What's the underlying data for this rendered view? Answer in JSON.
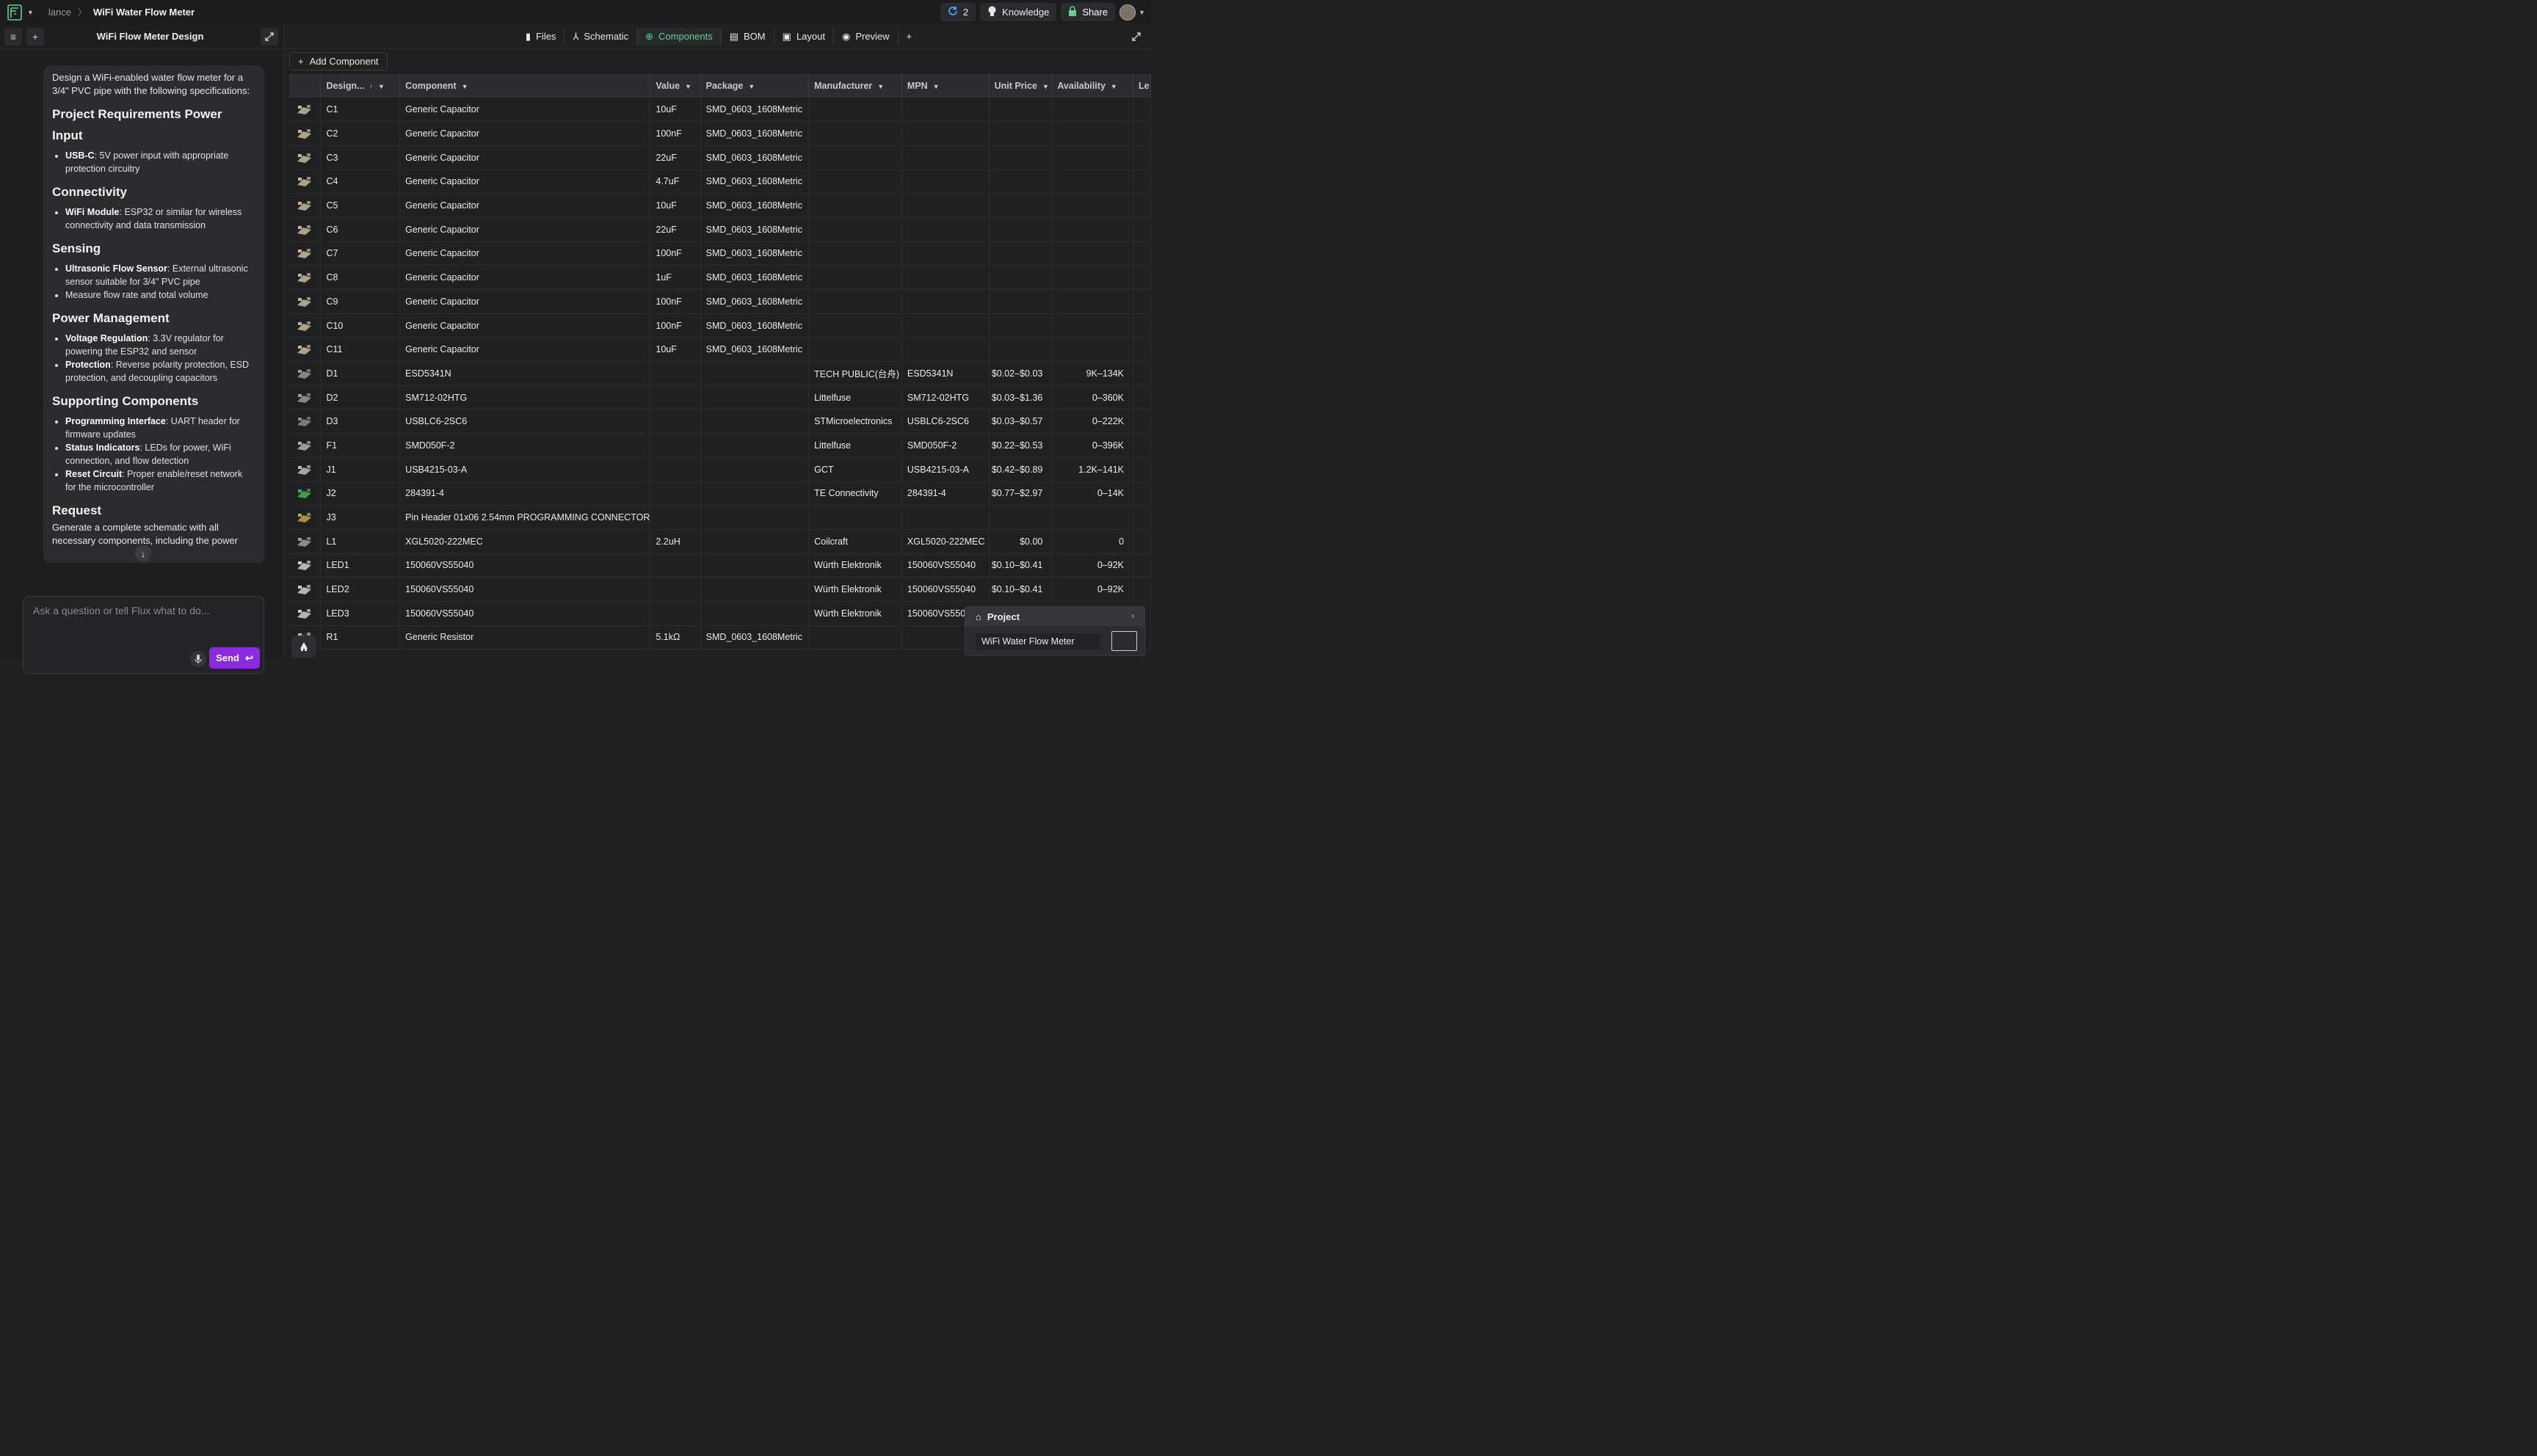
{
  "topbar": {
    "user": "lance",
    "project_title": "WiFi Water Flow Meter",
    "sync_count": "2",
    "knowledge_label": "Knowledge",
    "share_label": "Share"
  },
  "left": {
    "title": "WiFi Flow Meter Design",
    "intro": "Design a WiFi-enabled water flow meter for a 3/4\" PVC pipe with the following specifications:",
    "sections": [
      {
        "heading": "Project Requirements Power Input",
        "items": [
          {
            "bold": "USB-C",
            "text": ": 5V power input with appropriate protection circuitry"
          }
        ]
      },
      {
        "heading": "Connectivity",
        "items": [
          {
            "bold": "WiFi Module",
            "text": ": ESP32 or similar for wireless connectivity and data transmission"
          }
        ]
      },
      {
        "heading": "Sensing",
        "items": [
          {
            "bold": "Ultrasonic Flow Sensor",
            "text": ": External ultrasonic sensor suitable for 3/4\" PVC pipe"
          },
          {
            "bold": "",
            "text": "Measure flow rate and total volume"
          }
        ]
      },
      {
        "heading": "Power Management",
        "items": [
          {
            "bold": "Voltage Regulation",
            "text": ": 3.3V regulator for powering the ESP32 and sensor"
          },
          {
            "bold": "Protection",
            "text": ": Reverse polarity protection, ESD protection, and decoupling capacitors"
          }
        ]
      },
      {
        "heading": "Supporting Components",
        "items": [
          {
            "bold": "Programming Interface",
            "text": ": UART header for firmware updates"
          },
          {
            "bold": "Status Indicators",
            "text": ": LEDs for power, WiFi connection, and flow detection"
          },
          {
            "bold": "Reset Circuit",
            "text": ": Proper enable/reset network for the microcontroller"
          }
        ]
      },
      {
        "heading": "Request",
        "items": []
      }
    ],
    "request_text": "Generate a complete schematic with all necessary components, including the power",
    "input_placeholder": "Ask a question or tell Flux what to do...",
    "send_label": "Send"
  },
  "tabs": [
    "Files",
    "Schematic",
    "Components",
    "BOM",
    "Layout",
    "Preview"
  ],
  "active_tab": "Components",
  "add_component_label": "Add Component",
  "table": {
    "columns": [
      "Design...",
      "Component",
      "Value",
      "Package",
      "Manufacturer",
      "MPN",
      "Unit Price",
      "Availability",
      "Le"
    ],
    "rows": [
      {
        "d": "C1",
        "c": "Generic Capacitor",
        "v": "10uF",
        "p": "SMD_0603_1608Metric",
        "m": "",
        "mpn": "",
        "price": "",
        "avail": "",
        "icon": "capacitor-icon"
      },
      {
        "d": "C2",
        "c": "Generic Capacitor",
        "v": "100nF",
        "p": "SMD_0603_1608Metric",
        "m": "",
        "mpn": "",
        "price": "",
        "avail": "",
        "icon": "capacitor-icon"
      },
      {
        "d": "C3",
        "c": "Generic Capacitor",
        "v": "22uF",
        "p": "SMD_0603_1608Metric",
        "m": "",
        "mpn": "",
        "price": "",
        "avail": "",
        "icon": "capacitor-icon"
      },
      {
        "d": "C4",
        "c": "Generic Capacitor",
        "v": "4.7uF",
        "p": "SMD_0603_1608Metric",
        "m": "",
        "mpn": "",
        "price": "",
        "avail": "",
        "icon": "capacitor-icon"
      },
      {
        "d": "C5",
        "c": "Generic Capacitor",
        "v": "10uF",
        "p": "SMD_0603_1608Metric",
        "m": "",
        "mpn": "",
        "price": "",
        "avail": "",
        "icon": "capacitor-icon"
      },
      {
        "d": "C6",
        "c": "Generic Capacitor",
        "v": "22uF",
        "p": "SMD_0603_1608Metric",
        "m": "",
        "mpn": "",
        "price": "",
        "avail": "",
        "icon": "capacitor-icon"
      },
      {
        "d": "C7",
        "c": "Generic Capacitor",
        "v": "100nF",
        "p": "SMD_0603_1608Metric",
        "m": "",
        "mpn": "",
        "price": "",
        "avail": "",
        "icon": "capacitor-icon"
      },
      {
        "d": "C8",
        "c": "Generic Capacitor",
        "v": "1uF",
        "p": "SMD_0603_1608Metric",
        "m": "",
        "mpn": "",
        "price": "",
        "avail": "",
        "icon": "capacitor-icon"
      },
      {
        "d": "C9",
        "c": "Generic Capacitor",
        "v": "100nF",
        "p": "SMD_0603_1608Metric",
        "m": "",
        "mpn": "",
        "price": "",
        "avail": "",
        "icon": "capacitor-icon"
      },
      {
        "d": "C10",
        "c": "Generic Capacitor",
        "v": "100nF",
        "p": "SMD_0603_1608Metric",
        "m": "",
        "mpn": "",
        "price": "",
        "avail": "",
        "icon": "capacitor-icon"
      },
      {
        "d": "C11",
        "c": "Generic Capacitor",
        "v": "10uF",
        "p": "SMD_0603_1608Metric",
        "m": "",
        "mpn": "",
        "price": "",
        "avail": "",
        "icon": "capacitor-icon"
      },
      {
        "d": "D1",
        "c": "ESD5341N",
        "v": "",
        "p": "",
        "m": "TECH PUBLIC(台舟)",
        "mpn": "ESD5341N",
        "price": "$0.02–$0.03",
        "avail": "9K–134K",
        "icon": "diode-icon"
      },
      {
        "d": "D2",
        "c": "SM712-02HTG",
        "v": "",
        "p": "",
        "m": "Littelfuse",
        "mpn": "SM712-02HTG",
        "price": "$0.03–$1.36",
        "avail": "0–360K",
        "icon": "diode-icon"
      },
      {
        "d": "D3",
        "c": "USBLC6-2SC6",
        "v": "",
        "p": "",
        "m": "STMicroelectronics",
        "mpn": "USBLC6-2SC6",
        "price": "$0.03–$0.57",
        "avail": "0–222K",
        "icon": "ic-icon"
      },
      {
        "d": "F1",
        "c": "SMD050F-2",
        "v": "",
        "p": "",
        "m": "Littelfuse",
        "mpn": "SMD050F-2",
        "price": "$0.22–$0.53",
        "avail": "0–396K",
        "icon": "fuse-icon"
      },
      {
        "d": "J1",
        "c": "USB4215-03-A",
        "v": "",
        "p": "",
        "m": "GCT",
        "mpn": "USB4215-03-A",
        "price": "$0.42–$0.89",
        "avail": "1.2K–141K",
        "icon": "usb-connector-icon"
      },
      {
        "d": "J2",
        "c": "284391-4",
        "v": "",
        "p": "",
        "m": "TE Connectivity",
        "mpn": "284391-4",
        "price": "$0.77–$2.97",
        "avail": "0–14K",
        "icon": "terminal-block-icon"
      },
      {
        "d": "J3",
        "c": "Pin Header 01x06 2.54mm PROGRAMMING CONNECTOR",
        "v": "",
        "p": "",
        "m": "",
        "mpn": "",
        "price": "",
        "avail": "",
        "icon": "pin-header-icon"
      },
      {
        "d": "L1",
        "c": "XGL5020-222MEC",
        "v": "2.2uH",
        "p": "",
        "m": "Coilcraft",
        "mpn": "XGL5020-222MEC",
        "price": "$0.00",
        "avail": "0",
        "icon": "inductor-icon"
      },
      {
        "d": "LED1",
        "c": "150060VS55040",
        "v": "",
        "p": "",
        "m": "Würth Elektronik",
        "mpn": "150060VS55040",
        "price": "$0.10–$0.41",
        "avail": "0–92K",
        "icon": "led-icon"
      },
      {
        "d": "LED2",
        "c": "150060VS55040",
        "v": "",
        "p": "",
        "m": "Würth Elektronik",
        "mpn": "150060VS55040",
        "price": "$0.10–$0.41",
        "avail": "0–92K",
        "icon": "led-icon"
      },
      {
        "d": "LED3",
        "c": "150060VS55040",
        "v": "",
        "p": "",
        "m": "Würth Elektronik",
        "mpn": "150060VS55040",
        "price": "",
        "avail": "",
        "icon": "led-icon"
      },
      {
        "d": "R1",
        "c": "Generic Resistor",
        "v": "5.1kΩ",
        "p": "SMD_0603_1608Metric",
        "m": "",
        "mpn": "",
        "price": "",
        "avail": "",
        "icon": "resistor-icon"
      }
    ]
  },
  "project_popup": {
    "heading": "Project",
    "name": "WiFi Water Flow Meter"
  },
  "colors": {
    "accent_green": "#5fd38d",
    "send_purple": "#8a2be2"
  }
}
